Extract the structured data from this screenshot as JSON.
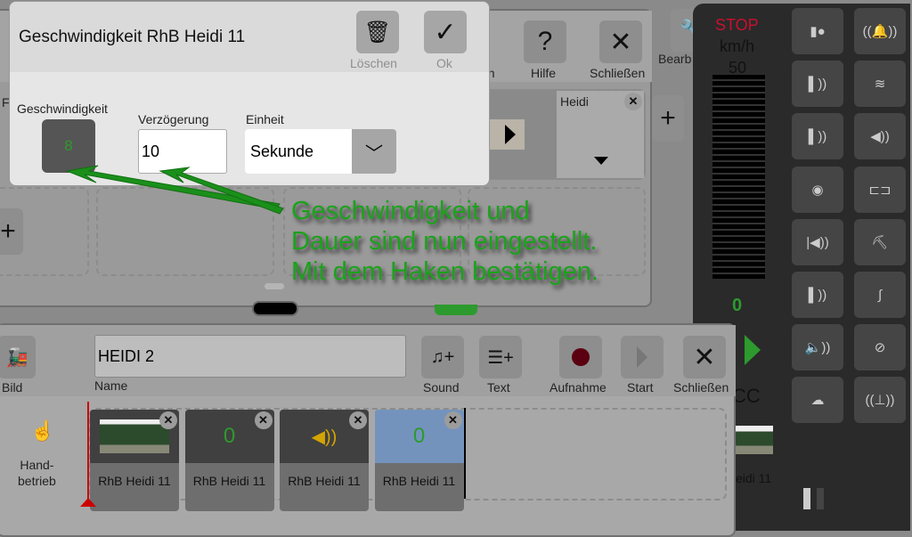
{
  "dialog": {
    "title": "Geschwindigkeit RhB Heidi 11",
    "delete_label": "Löschen",
    "ok_label": "Ok",
    "speed_label": "Geschwindigkeit",
    "speed_value": "8",
    "delay_label": "Verzögerung",
    "delay_value": "10",
    "unit_label": "Einheit",
    "unit_value": "Sekunde"
  },
  "back_window": {
    "partial_label": "en",
    "help_label": "Hilfe",
    "close_label": "Schließen",
    "edit_label": "Bearb",
    "card_name": "Heidi",
    "left_partial": "F"
  },
  "annotation": {
    "line1": "Geschwindigkeit und",
    "line2": "Dauer sind nun eingestellt.",
    "line3": "Mit dem Haken bestätigen."
  },
  "control": {
    "stop": "STOP",
    "unit": "km/h",
    "max_speed": "50",
    "current_speed": "0",
    "protocol": "CC",
    "loco_name": "eidi 11",
    "stop_color": "#c8102e",
    "accent": "#2d9a2d"
  },
  "functions": [
    "light-icon",
    "bell-icon",
    "whistle-icon",
    "steam-blow-icon",
    "whistle-icon",
    "horn-icon",
    "wheel-sound-icon",
    "compressor-icon",
    "horn-long-icon",
    "shovel-coal-icon",
    "whistle-icon",
    "water-crane-icon",
    "sound-icon",
    "brake-sound-icon",
    "smoke-icon",
    "water-pump-icon"
  ],
  "sequence": {
    "image_label": "Bild",
    "name_value": "HEIDI 2",
    "name_label": "Name",
    "sound_label": "Sound",
    "text_label": "Text",
    "record_label": "Aufnahme",
    "start_label": "Start",
    "close_label": "Schließen",
    "manual_label_1": "Hand-",
    "manual_label_2": "betrieb",
    "clips": [
      {
        "type": "image",
        "name": "RhB Heidi 11"
      },
      {
        "type": "speed",
        "value": "0",
        "name": "RhB Heidi 11"
      },
      {
        "type": "sound",
        "name": "RhB Heidi 11"
      },
      {
        "type": "speed",
        "value": "0",
        "name": "RhB Heidi 11",
        "selected": true
      }
    ]
  }
}
